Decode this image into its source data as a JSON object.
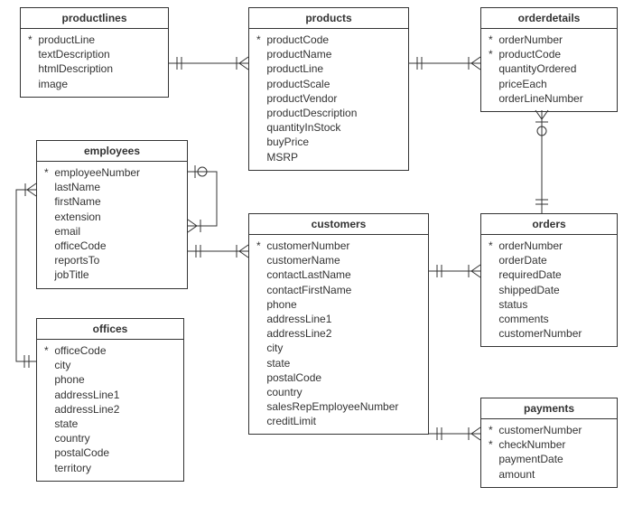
{
  "diagram": {
    "type": "entity-relationship",
    "entities": {
      "productlines": {
        "title": "productlines",
        "fields": [
          {
            "pk": true,
            "name": "productLine"
          },
          {
            "pk": false,
            "name": "textDescription"
          },
          {
            "pk": false,
            "name": "htmlDescription"
          },
          {
            "pk": false,
            "name": "image"
          }
        ]
      },
      "products": {
        "title": "products",
        "fields": [
          {
            "pk": true,
            "name": "productCode"
          },
          {
            "pk": false,
            "name": "productName"
          },
          {
            "pk": false,
            "name": "productLine"
          },
          {
            "pk": false,
            "name": "productScale"
          },
          {
            "pk": false,
            "name": "productVendor"
          },
          {
            "pk": false,
            "name": "productDescription"
          },
          {
            "pk": false,
            "name": "quantityInStock"
          },
          {
            "pk": false,
            "name": "buyPrice"
          },
          {
            "pk": false,
            "name": "MSRP"
          }
        ]
      },
      "orderdetails": {
        "title": "orderdetails",
        "fields": [
          {
            "pk": true,
            "name": "orderNumber"
          },
          {
            "pk": true,
            "name": "productCode"
          },
          {
            "pk": false,
            "name": "quantityOrdered"
          },
          {
            "pk": false,
            "name": "priceEach"
          },
          {
            "pk": false,
            "name": "orderLineNumber"
          }
        ]
      },
      "employees": {
        "title": "employees",
        "fields": [
          {
            "pk": true,
            "name": "employeeNumber"
          },
          {
            "pk": false,
            "name": "lastName"
          },
          {
            "pk": false,
            "name": "firstName"
          },
          {
            "pk": false,
            "name": "extension"
          },
          {
            "pk": false,
            "name": "email"
          },
          {
            "pk": false,
            "name": "officeCode"
          },
          {
            "pk": false,
            "name": "reportsTo"
          },
          {
            "pk": false,
            "name": "jobTitle"
          }
        ]
      },
      "customers": {
        "title": "customers",
        "fields": [
          {
            "pk": true,
            "name": "customerNumber"
          },
          {
            "pk": false,
            "name": "customerName"
          },
          {
            "pk": false,
            "name": "contactLastName"
          },
          {
            "pk": false,
            "name": "contactFirstName"
          },
          {
            "pk": false,
            "name": "phone"
          },
          {
            "pk": false,
            "name": "addressLine1"
          },
          {
            "pk": false,
            "name": "addressLine2"
          },
          {
            "pk": false,
            "name": "city"
          },
          {
            "pk": false,
            "name": "state"
          },
          {
            "pk": false,
            "name": "postalCode"
          },
          {
            "pk": false,
            "name": "country"
          },
          {
            "pk": false,
            "name": "salesRepEmployeeNumber"
          },
          {
            "pk": false,
            "name": "creditLimit"
          }
        ]
      },
      "orders": {
        "title": "orders",
        "fields": [
          {
            "pk": true,
            "name": "orderNumber"
          },
          {
            "pk": false,
            "name": "orderDate"
          },
          {
            "pk": false,
            "name": "requiredDate"
          },
          {
            "pk": false,
            "name": "shippedDate"
          },
          {
            "pk": false,
            "name": "status"
          },
          {
            "pk": false,
            "name": "comments"
          },
          {
            "pk": false,
            "name": "customerNumber"
          }
        ]
      },
      "offices": {
        "title": "offices",
        "fields": [
          {
            "pk": true,
            "name": "officeCode"
          },
          {
            "pk": false,
            "name": "city"
          },
          {
            "pk": false,
            "name": "phone"
          },
          {
            "pk": false,
            "name": "addressLine1"
          },
          {
            "pk": false,
            "name": "addressLine2"
          },
          {
            "pk": false,
            "name": "state"
          },
          {
            "pk": false,
            "name": "country"
          },
          {
            "pk": false,
            "name": "postalCode"
          },
          {
            "pk": false,
            "name": "territory"
          }
        ]
      },
      "payments": {
        "title": "payments",
        "fields": [
          {
            "pk": true,
            "name": "customerNumber"
          },
          {
            "pk": true,
            "name": "checkNumber"
          },
          {
            "pk": false,
            "name": "paymentDate"
          },
          {
            "pk": false,
            "name": "amount"
          }
        ]
      }
    },
    "relationships": [
      {
        "from": "productlines",
        "to": "products",
        "type": "one-to-many"
      },
      {
        "from": "products",
        "to": "orderdetails",
        "type": "one-to-many"
      },
      {
        "from": "orders",
        "to": "orderdetails",
        "type": "one-to-many"
      },
      {
        "from": "customers",
        "to": "orders",
        "type": "one-to-many"
      },
      {
        "from": "customers",
        "to": "payments",
        "type": "one-to-many"
      },
      {
        "from": "employees",
        "to": "customers",
        "type": "one-to-many"
      },
      {
        "from": "employees",
        "to": "employees",
        "type": "one-to-many",
        "note": "self-reference"
      },
      {
        "from": "offices",
        "to": "employees",
        "type": "one-to-many"
      }
    ]
  }
}
